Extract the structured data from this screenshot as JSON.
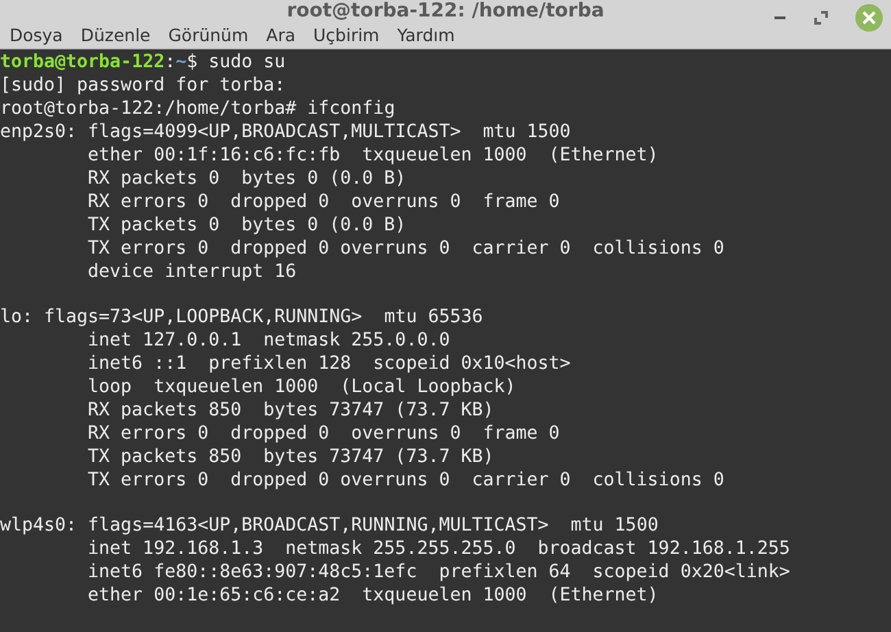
{
  "window": {
    "title": "root@torba-122: /home/torba"
  },
  "menu": [
    "Dosya",
    "Düzenle",
    "Görünüm",
    "Ara",
    "Uçbirim",
    "Yardım"
  ],
  "terminal": {
    "blocks": [
      {
        "lines": [
          {
            "kind": "prompt",
            "user_host": "torba@torba-122",
            "separator": ":",
            "path": "~",
            "rest": "$ sudo su"
          },
          {
            "kind": "output",
            "text": "[sudo] password for torba:"
          },
          {
            "kind": "output",
            "text": "root@torba-122:/home/torba# ifconfig"
          },
          {
            "kind": "output",
            "text": "enp2s0: flags=4099<UP,BROADCAST,MULTICAST>  mtu 1500"
          },
          {
            "kind": "detail",
            "text": "ether 00:1f:16:c6:fc:fb  txqueuelen 1000  (Ethernet)"
          },
          {
            "kind": "detail",
            "text": "RX packets 0  bytes 0 (0.0 B)"
          },
          {
            "kind": "detail",
            "text": "RX errors 0  dropped 0  overruns 0  frame 0"
          },
          {
            "kind": "detail",
            "text": "TX packets 0  bytes 0 (0.0 B)"
          },
          {
            "kind": "detail",
            "text": "TX errors 0  dropped 0 overruns 0  carrier 0  collisions 0"
          },
          {
            "kind": "detail",
            "text": "device interrupt 16"
          }
        ]
      },
      {
        "lines": [
          {
            "kind": "output",
            "text": "lo: flags=73<UP,LOOPBACK,RUNNING>  mtu 65536"
          },
          {
            "kind": "detail",
            "text": "inet 127.0.0.1  netmask 255.0.0.0"
          },
          {
            "kind": "detail",
            "text": "inet6 ::1  prefixlen 128  scopeid 0x10<host>"
          },
          {
            "kind": "detail",
            "text": "loop  txqueuelen 1000  (Local Loopback)"
          },
          {
            "kind": "detail",
            "text": "RX packets 850  bytes 73747 (73.7 KB)"
          },
          {
            "kind": "detail",
            "text": "RX errors 0  dropped 0  overruns 0  frame 0"
          },
          {
            "kind": "detail",
            "text": "TX packets 850  bytes 73747 (73.7 KB)"
          },
          {
            "kind": "detail",
            "text": "TX errors 0  dropped 0 overruns 0  carrier 0  collisions 0"
          }
        ]
      },
      {
        "lines": [
          {
            "kind": "output",
            "text": "wlp4s0: flags=4163<UP,BROADCAST,RUNNING,MULTICAST>  mtu 1500"
          },
          {
            "kind": "detail",
            "text": "inet 192.168.1.3  netmask 255.255.255.0  broadcast 192.168.1.255"
          },
          {
            "kind": "detail",
            "text": "inet6 fe80::8e63:907:48c5:1efc  prefixlen 64  scopeid 0x20<link>"
          },
          {
            "kind": "detail",
            "text": "ether 00:1e:65:c6:ce:a2  txqueuelen 1000  (Ethernet)"
          }
        ]
      }
    ]
  }
}
